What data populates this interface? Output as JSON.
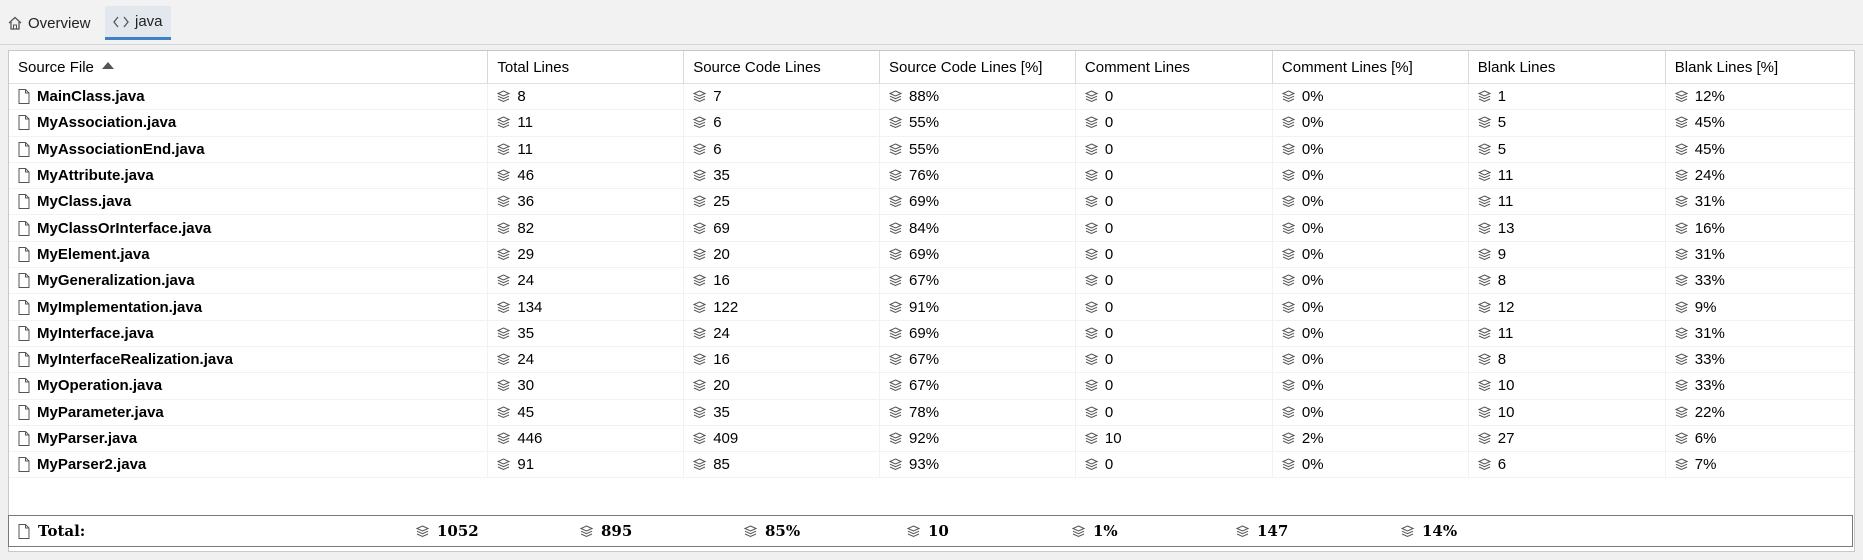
{
  "tabs": [
    {
      "label": "Overview",
      "icon": "home-icon",
      "active": false
    },
    {
      "label": "java",
      "icon": "code-icon",
      "active": true
    }
  ],
  "table": {
    "columns": [
      "Source File",
      "Total Lines",
      "Source Code Lines",
      "Source Code Lines [%]",
      "Comment Lines",
      "Comment Lines [%]",
      "Blank Lines",
      "Blank Lines [%]"
    ],
    "sort_column": "Source File",
    "sort_direction": "ascending",
    "rows": [
      [
        "MainClass.java",
        "8",
        "7",
        "88%",
        "0",
        "0%",
        "1",
        "12%"
      ],
      [
        "MyAssociation.java",
        "11",
        "6",
        "55%",
        "0",
        "0%",
        "5",
        "45%"
      ],
      [
        "MyAssociationEnd.java",
        "11",
        "6",
        "55%",
        "0",
        "0%",
        "5",
        "45%"
      ],
      [
        "MyAttribute.java",
        "46",
        "35",
        "76%",
        "0",
        "0%",
        "11",
        "24%"
      ],
      [
        "MyClass.java",
        "36",
        "25",
        "69%",
        "0",
        "0%",
        "11",
        "31%"
      ],
      [
        "MyClassOrInterface.java",
        "82",
        "69",
        "84%",
        "0",
        "0%",
        "13",
        "16%"
      ],
      [
        "MyElement.java",
        "29",
        "20",
        "69%",
        "0",
        "0%",
        "9",
        "31%"
      ],
      [
        "MyGeneralization.java",
        "24",
        "16",
        "67%",
        "0",
        "0%",
        "8",
        "33%"
      ],
      [
        "MyImplementation.java",
        "134",
        "122",
        "91%",
        "0",
        "0%",
        "12",
        "9%"
      ],
      [
        "MyInterface.java",
        "35",
        "24",
        "69%",
        "0",
        "0%",
        "11",
        "31%"
      ],
      [
        "MyInterfaceRealization.java",
        "24",
        "16",
        "67%",
        "0",
        "0%",
        "8",
        "33%"
      ],
      [
        "MyOperation.java",
        "30",
        "20",
        "67%",
        "0",
        "0%",
        "10",
        "33%"
      ],
      [
        "MyParameter.java",
        "45",
        "35",
        "78%",
        "0",
        "0%",
        "10",
        "22%"
      ],
      [
        "MyParser.java",
        "446",
        "409",
        "92%",
        "10",
        "2%",
        "27",
        "6%"
      ],
      [
        "MyParser2.java",
        "91",
        "85",
        "93%",
        "0",
        "0%",
        "6",
        "7%"
      ]
    ]
  },
  "total": [
    "Total:",
    "1052",
    "895",
    "85%",
    "10",
    "1%",
    "147",
    "14%"
  ]
}
